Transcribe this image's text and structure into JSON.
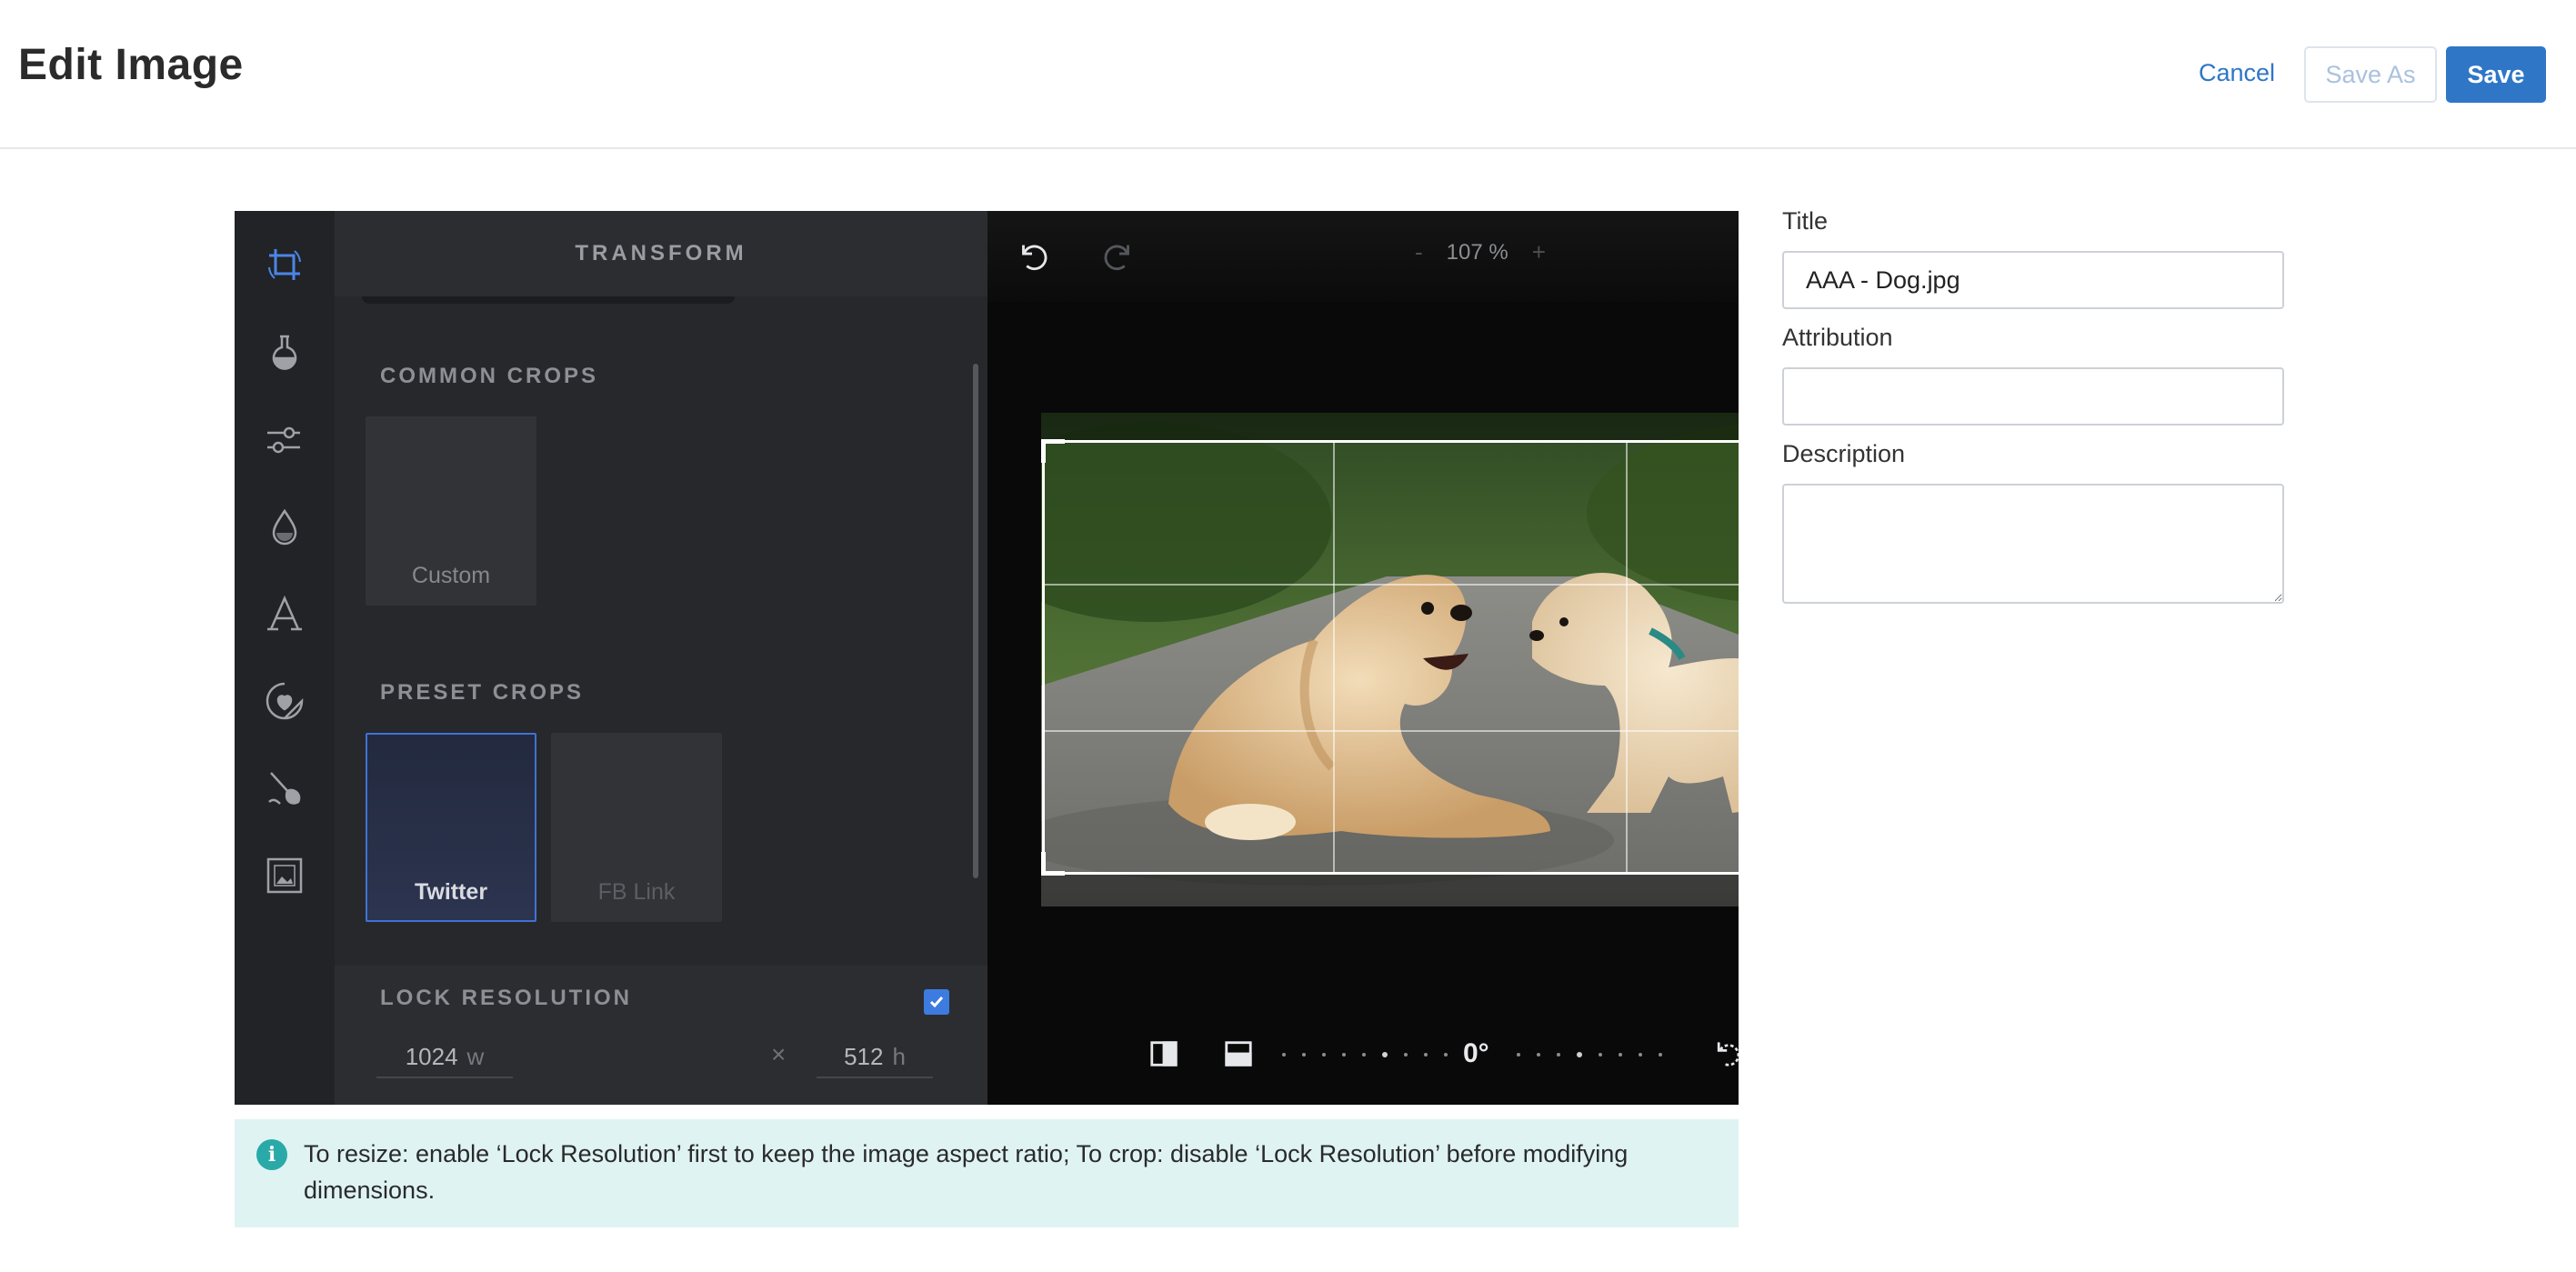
{
  "header": {
    "title": "Edit Image",
    "cancel_label": "Cancel",
    "save_as_label": "Save As",
    "save_label": "Save"
  },
  "toolbar": {
    "active_tool": "transform",
    "tools": [
      "crop-rotate-icon",
      "filter-icon",
      "adjust-icon",
      "drop-icon",
      "text-icon",
      "sticker-icon",
      "brush-icon",
      "frame-icon"
    ]
  },
  "panel": {
    "title": "TRANSFORM",
    "common_crops_label": "COMMON CROPS",
    "common_crops": [
      {
        "label": "Custom"
      }
    ],
    "preset_crops_label": "PRESET CROPS",
    "preset_crops": [
      {
        "label": "Twitter",
        "selected": true
      },
      {
        "label": "FB Link",
        "selected": false
      }
    ],
    "lock_resolution_label": "LOCK RESOLUTION",
    "lock_resolution_checked": true,
    "width_value": "1024",
    "width_unit": "w",
    "times_sign": "×",
    "height_value": "512",
    "height_unit": "h"
  },
  "canvas": {
    "zoom_minus": "-",
    "zoom_level": "107 %",
    "zoom_plus": "+",
    "rotation_angle": "0°"
  },
  "info": {
    "icon": "i",
    "message": "To resize: enable ‘Lock Resolution’ first to keep the image aspect ratio; To crop: disable ‘Lock Resolution’ before modifying dimensions."
  },
  "form": {
    "title_label": "Title",
    "title_value": "AAA - Dog.jpg",
    "attribution_label": "Attribution",
    "attribution_value": "",
    "description_label": "Description",
    "description_value": ""
  },
  "colors": {
    "accent": "#2f76c7",
    "editor_bg": "#090909",
    "panel_bg": "#27282b",
    "selection": "#3f72d6",
    "info_bg": "#dff3f3"
  }
}
